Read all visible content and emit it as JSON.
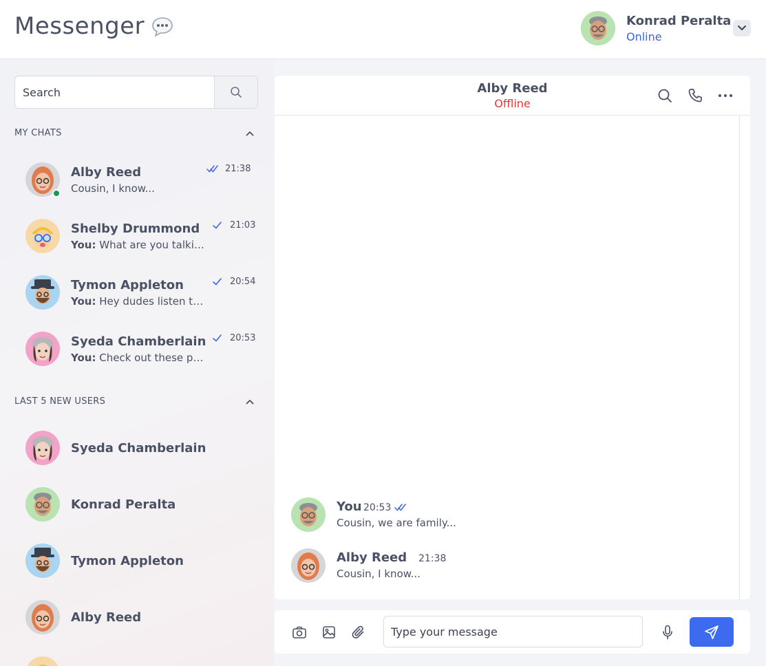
{
  "app": {
    "title": "Messenger"
  },
  "current_user": {
    "name": "Konrad Peralta",
    "status": "Online"
  },
  "search": {
    "placeholder": "Search"
  },
  "sections": {
    "my_chats": "MY CHATS",
    "new_users": "LAST 5 NEW USERS"
  },
  "chats": [
    {
      "name": "Alby Reed",
      "sender": "",
      "preview": "Cousin, I know...",
      "time": "21:38",
      "ticks": "double",
      "online": true
    },
    {
      "name": "Shelby Drummond",
      "sender": "You:",
      "preview": "What are you talking...",
      "time": "21:03",
      "ticks": "single",
      "online": false
    },
    {
      "name": "Tymon Appleton",
      "sender": "You:",
      "preview": "Hey dudes listen to ...",
      "time": "20:54",
      "ticks": "single",
      "online": false
    },
    {
      "name": "Syeda Chamberlain",
      "sender": "You:",
      "preview": "Check out these ph...",
      "time": "20:53",
      "ticks": "single",
      "online": false
    }
  ],
  "new_users": [
    {
      "name": "Syeda Chamberlain"
    },
    {
      "name": "Konrad Peralta"
    },
    {
      "name": "Tymon Appleton"
    },
    {
      "name": "Alby Reed"
    }
  ],
  "conversation": {
    "title": "Alby Reed",
    "status": "Offline",
    "messages": [
      {
        "author": "You",
        "time": "20:53",
        "text": "Cousin, we are family..."
      },
      {
        "author": "Alby Reed",
        "time": "21:38",
        "text": "Cousin, I know..."
      }
    ]
  },
  "composer": {
    "placeholder": "Type your message"
  },
  "colors": {
    "accent": "#3d6bf0",
    "online": "#3b63e8",
    "offline": "#e33b3b",
    "online_dot": "#159a5a"
  },
  "icons": [
    "speech-bubble-icon",
    "chevron-down-icon",
    "search-icon",
    "chevron-up-icon",
    "double-check-icon",
    "check-icon",
    "phone-icon",
    "more-icon",
    "camera-icon",
    "image-icon",
    "paperclip-icon",
    "microphone-icon",
    "send-icon"
  ]
}
